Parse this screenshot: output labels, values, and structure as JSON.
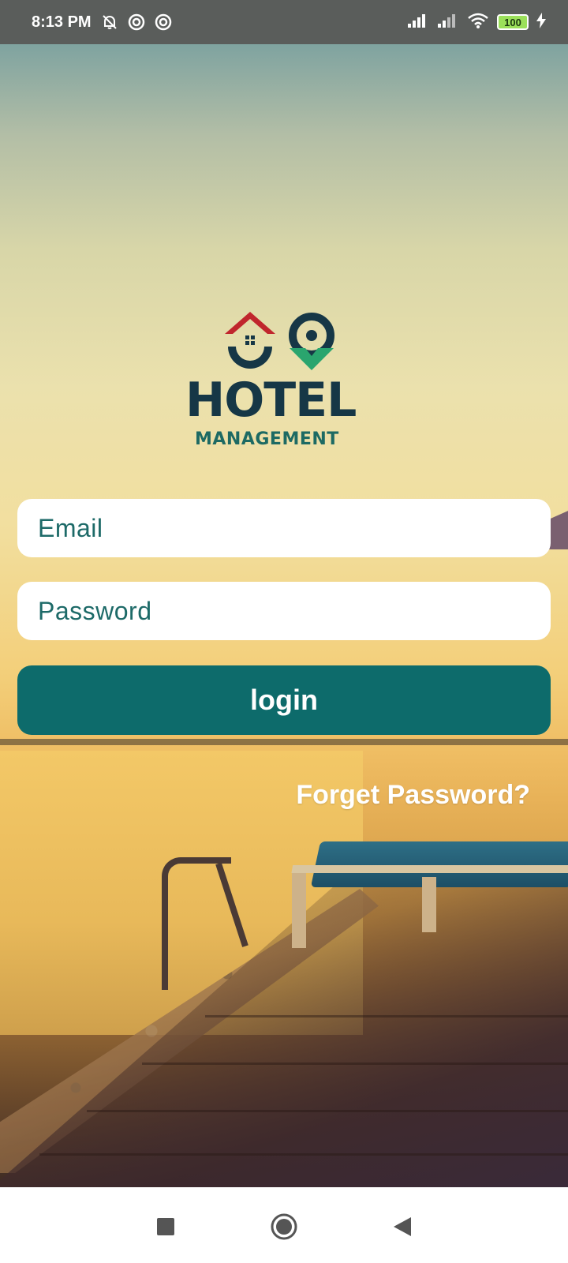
{
  "status_bar": {
    "time": "8:13 PM",
    "battery": "100",
    "icons": [
      "mute-bell-icon",
      "app-notification-icon",
      "app-notification-icon",
      "cellular-signal-icon",
      "cellular-signal-icon",
      "wifi-icon",
      "battery-icon",
      "charging-bolt-icon"
    ]
  },
  "logo": {
    "title": "HOTEL",
    "subtitle": "MANAGEMENT",
    "colors": {
      "red": "#c0262d",
      "green": "#2aa56e",
      "dark": "#163746",
      "teal": "#1d6a63"
    }
  },
  "form": {
    "email_placeholder": "Email",
    "password_placeholder": "Password",
    "login_label": "login",
    "forgot_label": "Forget Password?"
  },
  "colors": {
    "button": "#0d6b6b",
    "input_text": "#1d6a68"
  },
  "nav_bar": {
    "icons": [
      "recents-square-icon",
      "home-circle-icon",
      "back-triangle-icon"
    ]
  }
}
